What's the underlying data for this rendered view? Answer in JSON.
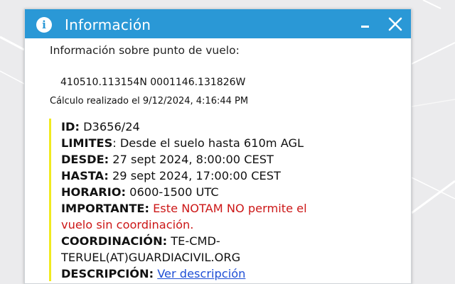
{
  "panel": {
    "title": "Información",
    "info_icon_glyph": "i",
    "minimize_icon": "minimize-icon",
    "close_icon": "close-icon",
    "header_color": "#2a98d6"
  },
  "content": {
    "heading": "Información sobre punto de vuelo:",
    "coordinates": "410510.113154N 0001146.131826W",
    "calc_text": "Cálculo realizado el 9/12/2024, 4:16:44 PM"
  },
  "notam": {
    "accent_color": "#f1ea1f",
    "id_label": "ID:",
    "id_value": " D3656/24",
    "limits_label": "LIMITES",
    "limits_value": ": Desde el suelo hasta 610m AGL",
    "from_label": "DESDE:",
    "from_value": " 27 sept 2024, 8:00:00 CEST",
    "to_label": "HASTA:",
    "to_value": " 29 sept 2024, 17:00:00 CEST",
    "schedule_label": "HORARIO:",
    "schedule_value": " 0600-1500 UTC",
    "important_label": "IMPORTANTE:",
    "important_line1": " Este NOTAM NO permite el",
    "important_line2": "vuelo sin coordinación.",
    "coordination_label": "COORDINACIÓN:",
    "coordination_line1": " TE-CMD-",
    "coordination_line2": "TERUEL(AT)GUARDIACIVIL.ORG",
    "description_label": "DESCRIPCIÓN:",
    "description_link": "Ver descripción"
  }
}
